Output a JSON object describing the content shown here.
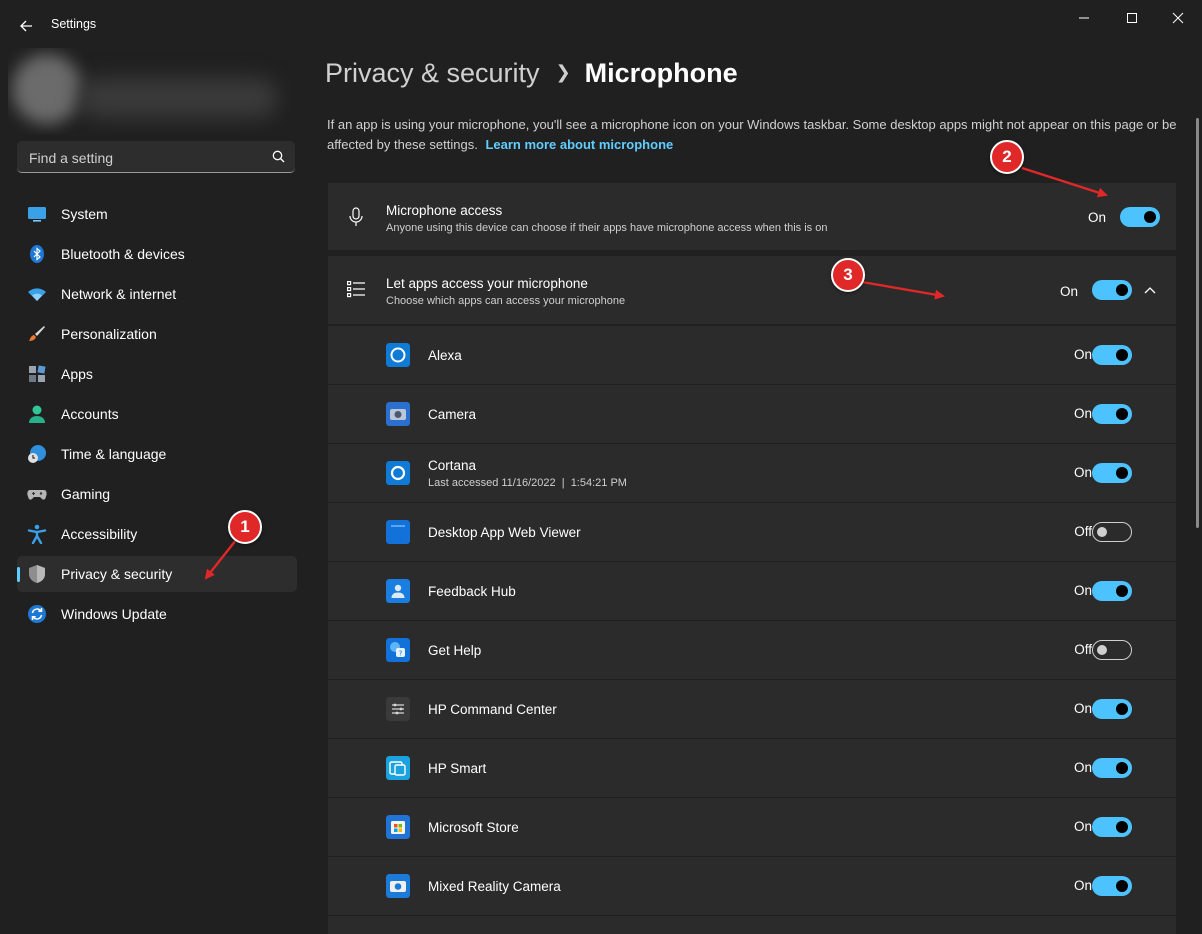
{
  "window": {
    "title": "Settings"
  },
  "sidebar": {
    "search": {
      "placeholder": "Find a setting"
    },
    "items": [
      {
        "label": "System",
        "icon": "monitor-icon"
      },
      {
        "label": "Bluetooth & devices",
        "icon": "bluetooth-icon"
      },
      {
        "label": "Network & internet",
        "icon": "wifi-icon"
      },
      {
        "label": "Personalization",
        "icon": "paintbrush-icon"
      },
      {
        "label": "Apps",
        "icon": "apps-icon"
      },
      {
        "label": "Accounts",
        "icon": "person-icon"
      },
      {
        "label": "Time & language",
        "icon": "globe-clock-icon"
      },
      {
        "label": "Gaming",
        "icon": "gamepad-icon"
      },
      {
        "label": "Accessibility",
        "icon": "accessibility-icon"
      },
      {
        "label": "Privacy & security",
        "icon": "shield-icon",
        "active": true
      },
      {
        "label": "Windows Update",
        "icon": "update-icon"
      }
    ]
  },
  "main": {
    "breadcrumb": {
      "parent": "Privacy & security",
      "current": "Microphone"
    },
    "description": "If an app is using your microphone, you'll see a microphone icon on your Windows taskbar. Some desktop apps might not appear on this page or be affected by these settings.",
    "learn_more": "Learn more about microphone",
    "microphone_access": {
      "title": "Microphone access",
      "subtitle": "Anyone using this device can choose if their apps have microphone access when this is on",
      "state": "On"
    },
    "let_apps": {
      "title": "Let apps access your microphone",
      "subtitle": "Choose which apps can access your microphone",
      "state": "On"
    },
    "apps": [
      {
        "name": "Alexa",
        "state": "On",
        "on": true,
        "icon": "alexa-icon",
        "color": "#0f7bd6"
      },
      {
        "name": "Camera",
        "state": "On",
        "on": true,
        "icon": "camera-icon",
        "color": "#2b6fcf"
      },
      {
        "name": "Cortana",
        "last": "Last accessed 11/16/2022  |  1:54:21 PM",
        "state": "On",
        "on": true,
        "icon": "cortana-icon",
        "color": "#0f7bd6"
      },
      {
        "name": "Desktop App Web Viewer",
        "state": "Off",
        "on": false,
        "icon": "web-viewer-icon",
        "color": "#1372d9"
      },
      {
        "name": "Feedback Hub",
        "state": "On",
        "on": true,
        "icon": "feedback-hub-icon",
        "color": "#1a7ee0"
      },
      {
        "name": "Get Help",
        "state": "Off",
        "on": false,
        "icon": "get-help-icon",
        "color": "#1372d9"
      },
      {
        "name": "HP Command Center",
        "state": "On",
        "on": true,
        "icon": "hp-command-center-icon",
        "color": "#3a3a3a"
      },
      {
        "name": "HP Smart",
        "state": "On",
        "on": true,
        "icon": "hp-smart-icon",
        "color": "#1aa3e0"
      },
      {
        "name": "Microsoft Store",
        "state": "On",
        "on": true,
        "icon": "store-icon",
        "color": "#2173d6"
      },
      {
        "name": "Mixed Reality Camera",
        "state": "On",
        "on": true,
        "icon": "mixed-reality-camera-icon",
        "color": "#1c7ad9"
      }
    ]
  },
  "annotations": {
    "badges": [
      "1",
      "2",
      "3"
    ],
    "color": "#e02828"
  },
  "colors": {
    "accent": "#4cc2ff",
    "link": "#60cdff",
    "background": "#202020",
    "card": "#2b2b2b"
  }
}
